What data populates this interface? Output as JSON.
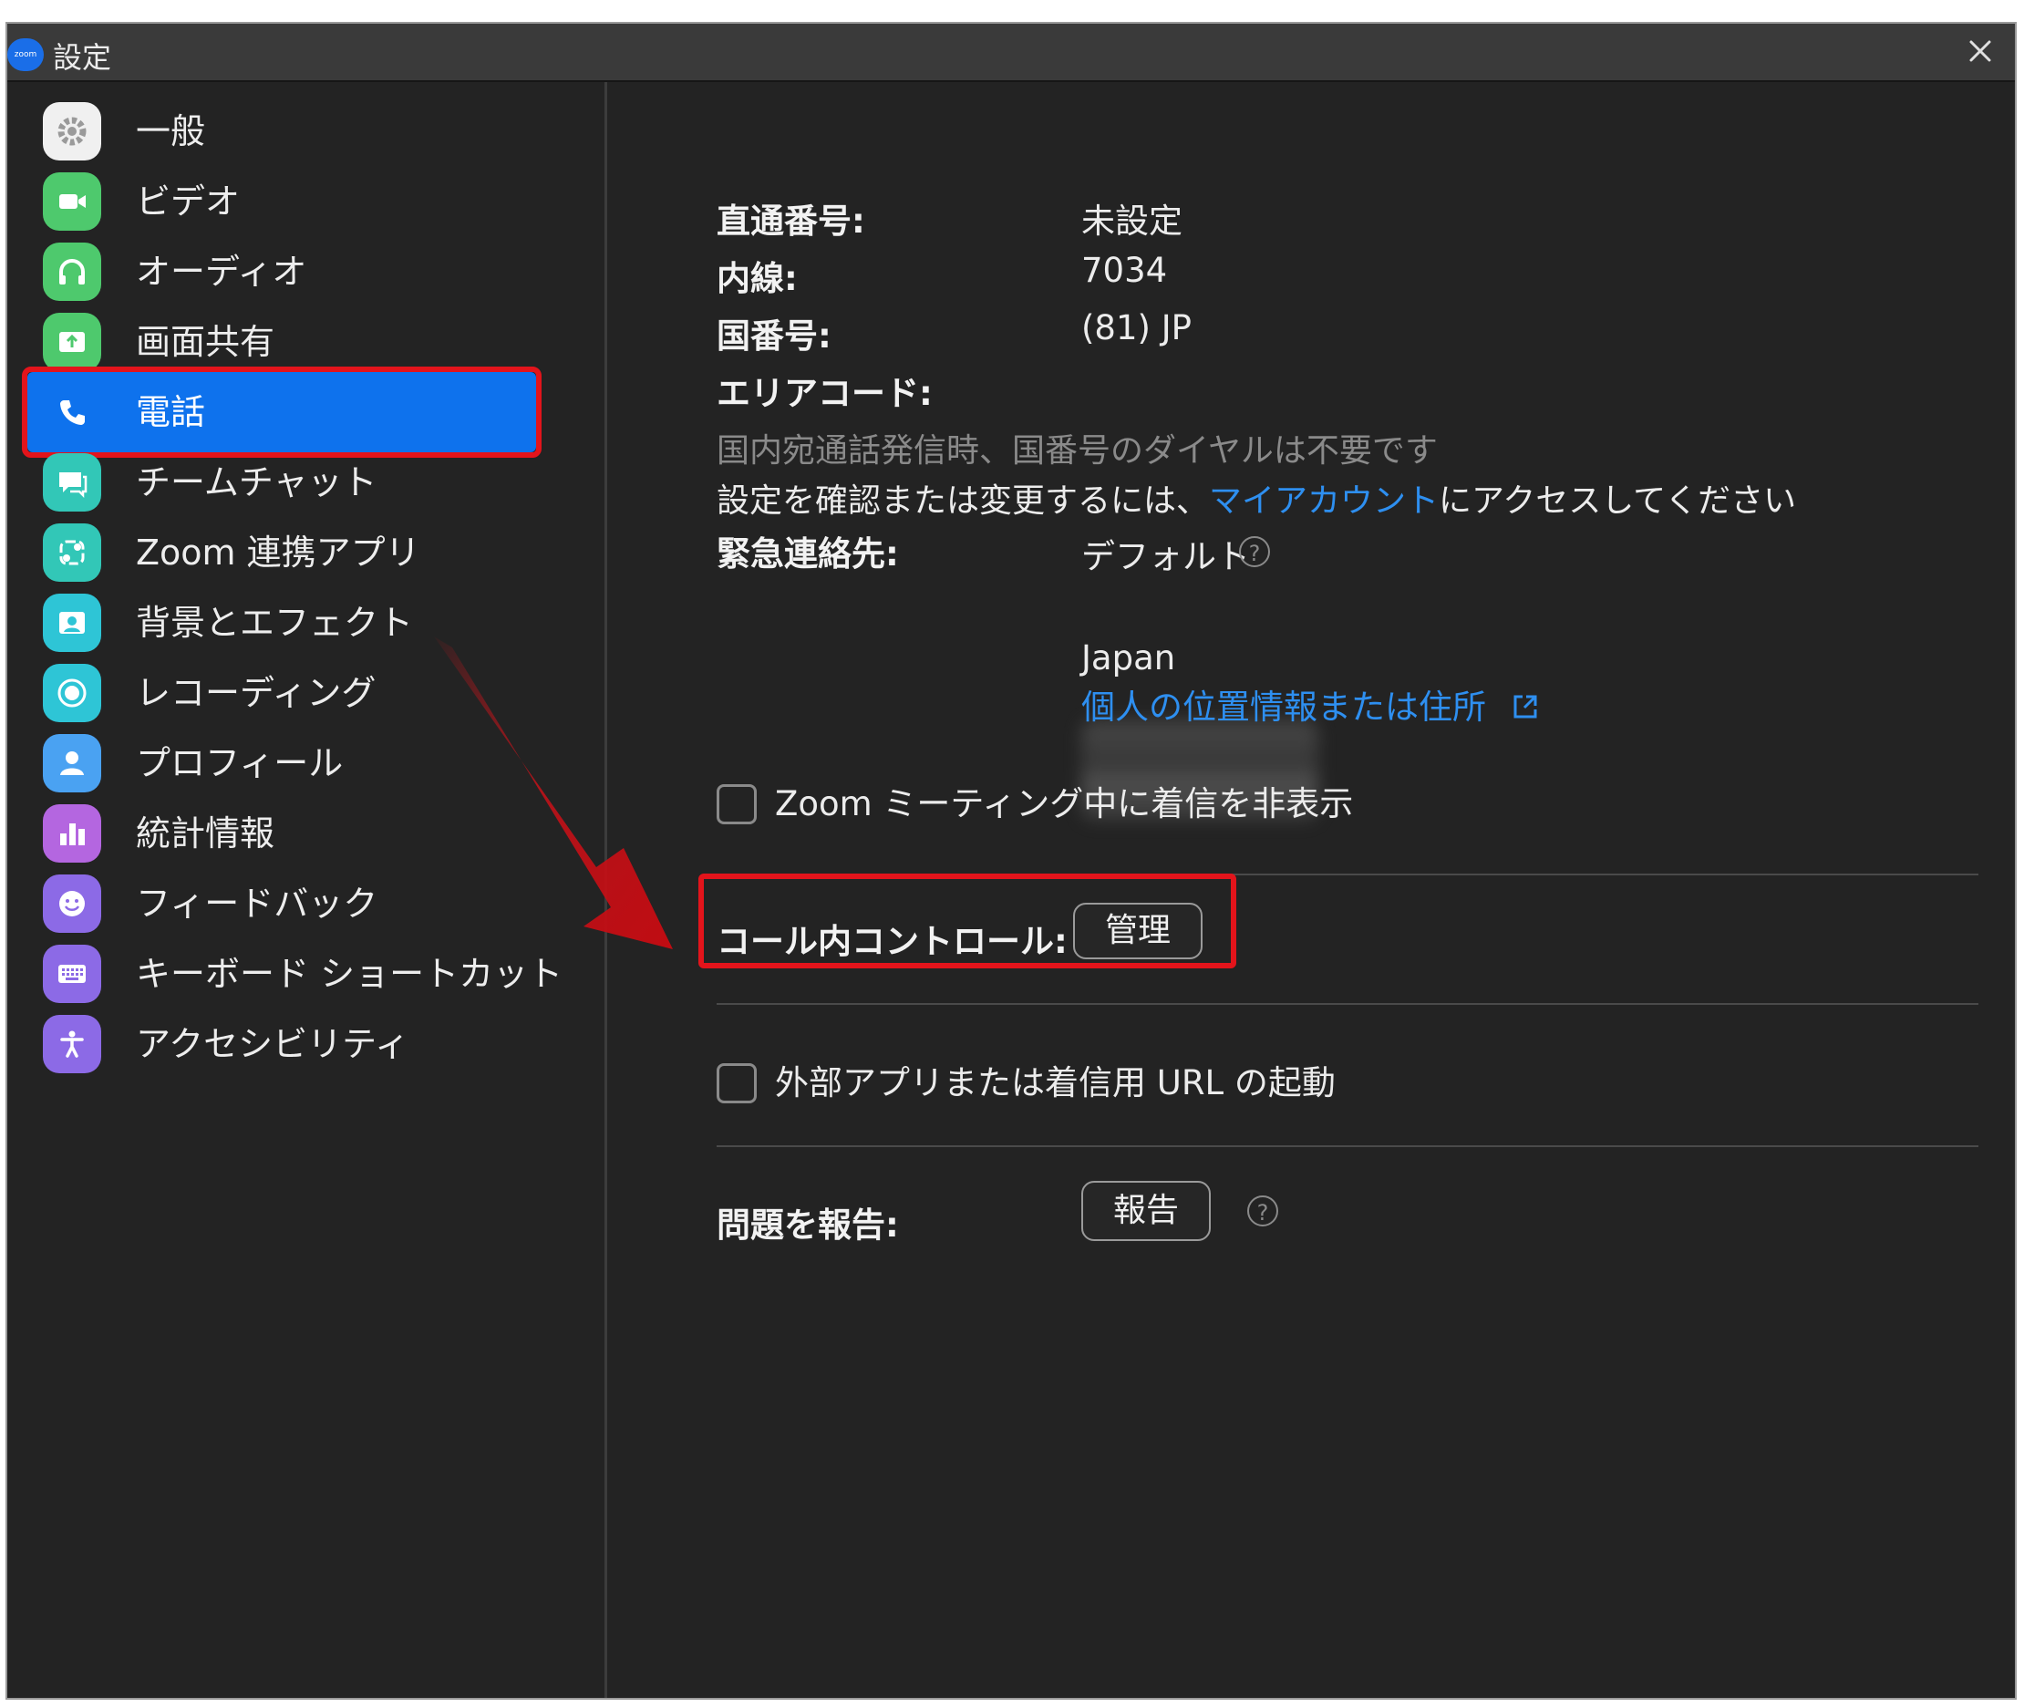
{
  "window": {
    "title": "設定",
    "logo_text": "zoom",
    "close_icon": "close-icon"
  },
  "sidebar": {
    "items": [
      {
        "label": "一般",
        "icon": "gear-icon",
        "color": "#f0f0f0"
      },
      {
        "label": "ビデオ",
        "icon": "video-camera-icon",
        "color": "#4ec96d"
      },
      {
        "label": "オーディオ",
        "icon": "headphones-icon",
        "color": "#4ec96d"
      },
      {
        "label": "画面共有",
        "icon": "share-screen-icon",
        "color": "#4ec96d"
      },
      {
        "label": "電話",
        "icon": "phone-icon",
        "color": "#0e72ed"
      },
      {
        "label": "チームチャット",
        "icon": "chat-icon",
        "color": "#32c7b7"
      },
      {
        "label": "Zoom 連携アプリ",
        "icon": "apps-icon",
        "color": "#32c7b7"
      },
      {
        "label": "背景とエフェクト",
        "icon": "background-icon",
        "color": "#2ec5d6"
      },
      {
        "label": "レコーディング",
        "icon": "record-icon",
        "color": "#2ec5d6"
      },
      {
        "label": "プロフィール",
        "icon": "profile-icon",
        "color": "#4aa2f2"
      },
      {
        "label": "統計情報",
        "icon": "statistics-icon",
        "color": "#b466e0"
      },
      {
        "label": "フィードバック",
        "icon": "feedback-icon",
        "color": "#8c6ae6"
      },
      {
        "label": "キーボード ショートカット",
        "icon": "keyboard-icon",
        "color": "#8c6ae6"
      },
      {
        "label": "アクセシビリティ",
        "icon": "accessibility-icon",
        "color": "#8c6ae6"
      }
    ],
    "active": "電話"
  },
  "phone": {
    "direct_number_label": "直通番号:",
    "direct_number_value": "未設定",
    "extension_label": "内線:",
    "extension_value": "7034",
    "country_code_label": "国番号:",
    "country_code_value": "(81) JP",
    "area_code_label": "エリアコード:",
    "domestic_note": "国内宛通話発信時、国番号のダイヤルは不要です",
    "settings_note_prefix": "設定を確認または変更するには、",
    "settings_note_link": "マイアカウント",
    "settings_note_suffix": "にアクセスしてください",
    "emergency_label": "緊急連絡先:",
    "emergency_default": "デフォルト",
    "emergency_country": "Japan",
    "location_link": "個人の位置情報または住所",
    "hide_calls_label": "Zoom ミーティング中に着信を非表示",
    "hide_calls_checked": false,
    "in_call_controls_label": "コール内コントロール:",
    "manage_button": "管理",
    "launch_url_label": "外部アプリまたは着信用 URL の起動",
    "launch_url_checked": false,
    "report_label": "問題を報告:",
    "report_button": "報告"
  },
  "annotation": {
    "highlight_color": "#e3141b"
  }
}
